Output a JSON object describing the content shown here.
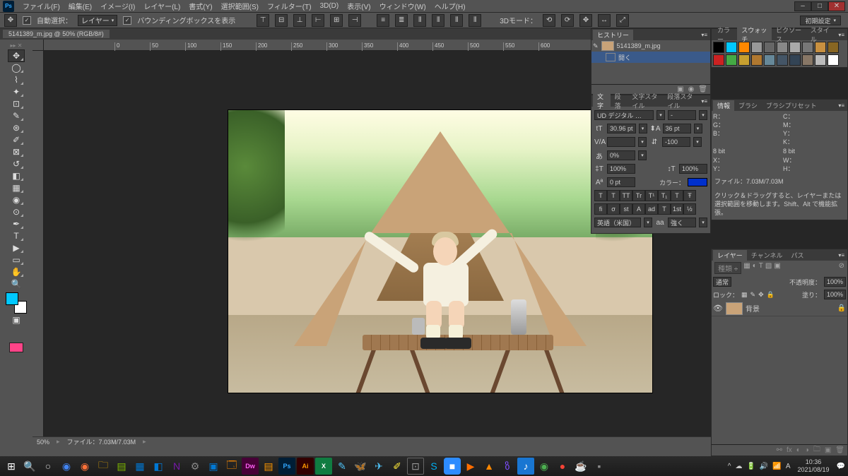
{
  "menubar": {
    "items": [
      "ファイル(F)",
      "編集(E)",
      "イメージ(I)",
      "レイヤー(L)",
      "書式(Y)",
      "選択範囲(S)",
      "フィルター(T)",
      "3D(D)",
      "表示(V)",
      "ウィンドウ(W)",
      "ヘルプ(H)"
    ]
  },
  "optionbar": {
    "auto_select_cb": true,
    "auto_select_label": "自動選択：",
    "auto_select_target": "レイヤー",
    "bounding_box_cb": true,
    "bounding_box_label": "バウンディングボックスを表示",
    "threed_label": "3Dモード：",
    "workspace_dd": "初期設定"
  },
  "document_tab": "5141389_m.jpg @ 50% (RGB/8#)",
  "canvas_status": {
    "zoom": "50%",
    "filesize": "ファイル：7.03M/7.03M"
  },
  "ruler_marks": [
    "0",
    "50",
    "100",
    "150",
    "200",
    "250",
    "300",
    "350",
    "400",
    "450",
    "500",
    "550",
    "600"
  ],
  "history_panel": {
    "tab": "ヒストリー",
    "file_row": "5141389_m.jpg",
    "step_row": "開く"
  },
  "swatches_panel": {
    "tabs": [
      "カラー",
      "スウォッチ",
      "ピクソース",
      "スタイル"
    ],
    "colors_row1": [
      "#000000",
      "#00c8ff",
      "#ff8800",
      "#999999",
      "#666666",
      "#888888",
      "#aaaaaa",
      "#777777",
      "#c89040",
      "#886622"
    ],
    "colors_row2": [
      "#cc2222",
      "#44aa44",
      "#c8a030",
      "#b07830",
      "#668899",
      "#445566",
      "#334455",
      "#887766",
      "#bbbbbb",
      "#ffffff"
    ]
  },
  "character_panel": {
    "tabs": [
      "文字",
      "段落",
      "文字スタイル",
      "段落スタイル"
    ],
    "font": "UD デジタル …",
    "style": "-",
    "size": "30.96 pt",
    "leading": "36 pt",
    "va_label": "V/A",
    "tracking": "-100",
    "scale_v": "0%",
    "scale_h": "100%",
    "baseline": "0 pt",
    "color_label": "カラー：",
    "tt_buttons": [
      "T",
      "T",
      "TT",
      "Tr",
      "T¹",
      "T₁",
      "T",
      "Ŧ"
    ],
    "opentype": [
      "ﬁ",
      "σ",
      "st",
      "A",
      "ad",
      "T",
      "1st",
      "½"
    ],
    "lang": "英語（米国）",
    "aa_label": "aa",
    "aa_val": "強く"
  },
  "info_panel": {
    "tabs": [
      "情報",
      "ブラシ",
      "ブラシプリセット"
    ],
    "rgb": {
      "R": "",
      "G": "",
      "B": ""
    },
    "cmyk": {
      "C": "",
      "M": "",
      "Y": "",
      "K": ""
    },
    "eightbit": "8 bit",
    "xy": {
      "X": "",
      "Y": ""
    },
    "wh": {
      "W": "",
      "H": ""
    },
    "file": "ファイル：7.03M/7.03M",
    "hint": "クリック＆ドラッグすると、レイヤーまたは選択範囲を移動します。Shift、Alt で機能拡張。"
  },
  "layers_panel": {
    "tabs": [
      "レイヤー",
      "チャンネル",
      "パス"
    ],
    "kind": "種類",
    "mode": "通常",
    "opacity_label": "不透明度：",
    "opacity": "100%",
    "lock_label": "ロック：",
    "fill_label": "塗り：",
    "fill": "100%",
    "layer_name": "背景"
  },
  "taskbar": {
    "clock_time": "10:36",
    "clock_date": "2021/08/19",
    "ime": "A"
  }
}
